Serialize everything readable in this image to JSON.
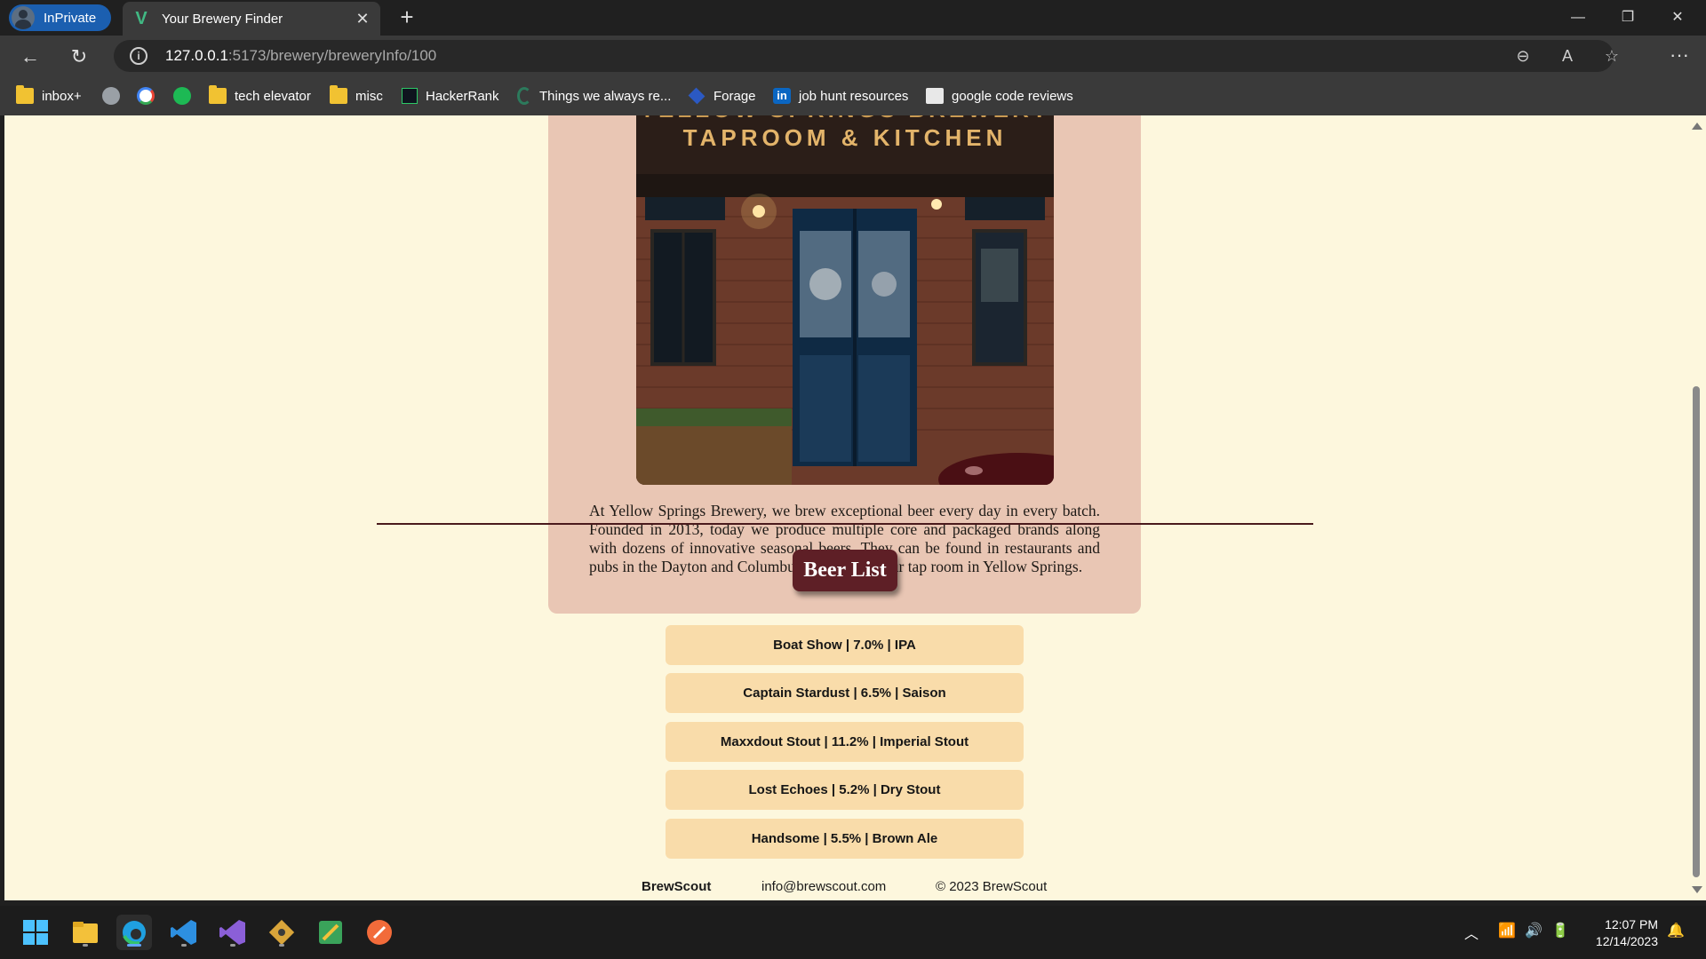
{
  "browser": {
    "profile_label": "InPrivate",
    "tab_title": "Your Brewery Finder",
    "url_host": "127.0.0.1",
    "url_rest": ":5173/brewery/breweryInfo/100",
    "bookmarks": [
      "inbox+",
      "tech elevator",
      "misc",
      "HackerRank",
      "Things we always re...",
      "Forage",
      "job hunt resources",
      "google code reviews"
    ]
  },
  "page": {
    "photo_sign_line1": "YELLOW SPRINGS BREWERY",
    "photo_sign_line2": "TAPROOM & KITCHEN",
    "description": "At Yellow Springs Brewery, we brew exceptional beer every day in every batch. Founded in 2013, today we produce multiple core and packaged brands along with dozens of innovative seasonal beers. They can be found in restaurants and pubs in the Dayton and Columbus areas and in our tap room in Yellow Springs.",
    "beer_list_title": "Beer List",
    "beers": [
      "Boat Show | 7.0% | IPA",
      "Captain Stardust | 6.5% | Saison",
      "Maxxdout Stout | 11.2% | Imperial Stout",
      "Lost Echoes | 5.2% | Dry Stout",
      "Handsome | 5.5% | Brown Ale"
    ],
    "footer": {
      "brand": "BrewScout",
      "email": "info@brewscout.com",
      "copyright": "© 2023 BrewScout"
    }
  },
  "taskbar": {
    "time": "12:07 PM",
    "date": "12/14/2023"
  },
  "colors": {
    "page_bg": "#fdf7dd",
    "card_bg": "#e9c6b4",
    "beer_title_bg": "#5e1f26",
    "beer_item_bg": "#f9dcaa",
    "divider": "#4a1a1c"
  }
}
